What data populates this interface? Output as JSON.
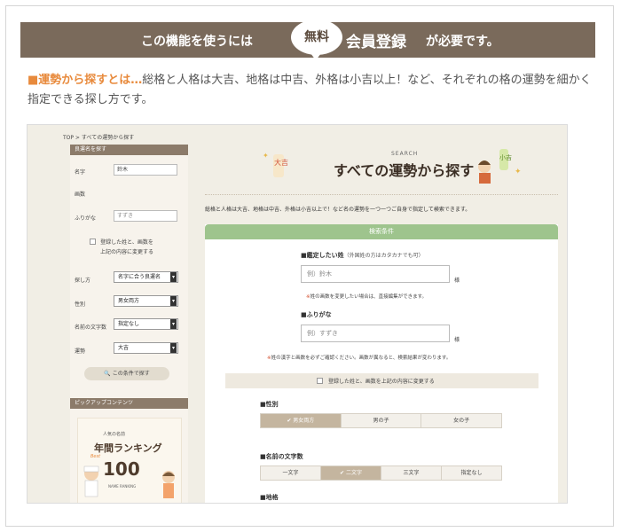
{
  "banner": {
    "prefix": "この機能を使うには",
    "badge": "無料",
    "member": "会員登録",
    "suffix": "が必要です。"
  },
  "intro": {
    "highlight": "■運勢から探すとは…",
    "body": "総格と人格は大吉、地格は中吉、外格は小吉以上！など、それぞれの格の運勢を細かく指定できる探し方です。"
  },
  "screenshot": {
    "breadcrumb": "TOP > すべての運勢から探す",
    "sidebar": {
      "header": "良運名を探す",
      "name_label": "名字",
      "name_value": "鈴木",
      "strokes_label": "画数",
      "furigana_label": "ふりがな",
      "furigana_value": "すずき",
      "check_line1": "登録した姓と、画数を",
      "check_line2": "上記の内容に変更する",
      "how_label": "探し方",
      "how_value": "名字に合う良運名",
      "gender_label": "性別",
      "gender_value": "男女両方",
      "chars_label": "名前の文字数",
      "chars_value": "指定なし",
      "fortune_label": "運勢",
      "fortune_value": "大吉",
      "search_button": "この条件で探す",
      "pickup_header": "ピックアップコンテンツ",
      "rank_small": "人気の名前",
      "rank_title": "年間ランキング",
      "rank_best": "Best",
      "rank_number": "100",
      "rank_caption": "NAME RANKING"
    },
    "main": {
      "search_tag": "SEARCH",
      "title": "すべての運勢から探す",
      "deco_left": "大吉",
      "deco_right": "小吉",
      "description": "総格と人格は大吉、地格は中吉、外格は小吉以上で！など名の運勢を一つ一つご自身で指定して検索できます。",
      "panel_header": "検索条件",
      "surname_label": "■鑑定したい姓",
      "surname_sub": "（外国姓の方はカタカナでも可）",
      "surname_placeholder": "例）鈴木",
      "sama1": "様",
      "surname_note": "姓の画数を変更したい場合は、直接編集ができます。",
      "furigana_label": "■ふりがな",
      "furigana_placeholder": "例）すずき",
      "sama2": "様",
      "furigana_note": "姓の漢字と画数を必ずご確認ください。画数が異なると、検索結果が変わります。",
      "check_text": "登録した姓と、画数を上記の内容に変更する",
      "gender_label": "■性別",
      "gender_options": [
        "✔ 男女両方",
        "男の子",
        "女の子"
      ],
      "chars_label": "■名前の文字数",
      "chars_options": [
        "一文字",
        "✔ 二文字",
        "三文字",
        "指定なし"
      ],
      "earth_label": "■地格"
    }
  }
}
